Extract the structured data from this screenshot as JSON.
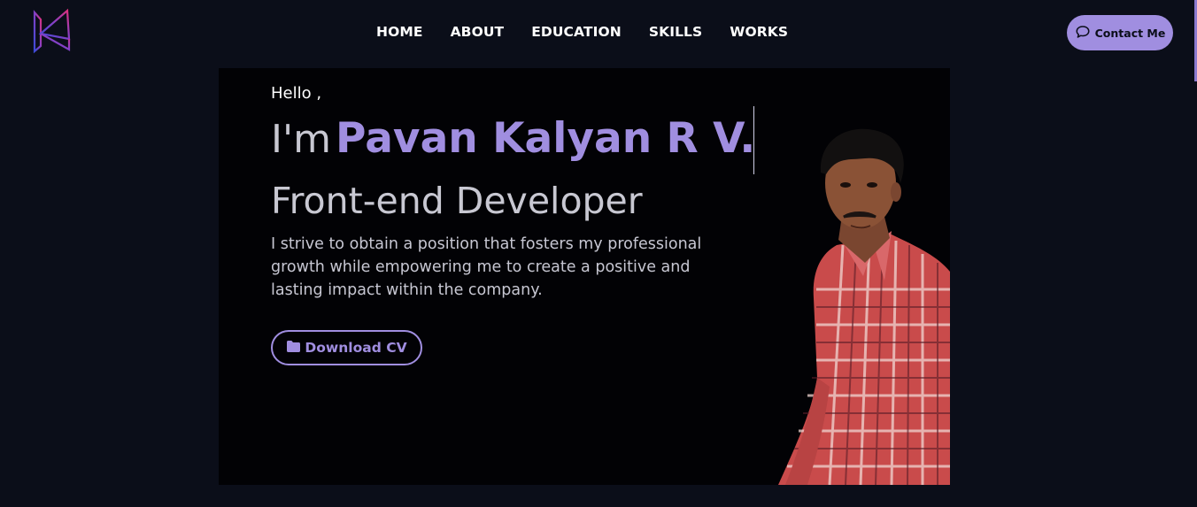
{
  "header": {
    "logo_icon": "k-logo-icon",
    "nav": [
      {
        "label": "HOME"
      },
      {
        "label": "ABOUT"
      },
      {
        "label": "EDUCATION"
      },
      {
        "label": "SKILLS"
      },
      {
        "label": "WORKS"
      }
    ],
    "contact": {
      "label": "Contact Me",
      "icon": "chat-bubble-icon"
    }
  },
  "hero": {
    "greeting": "Hello ,",
    "im": "I'm",
    "name": "Pavan Kalyan R V.",
    "role": "Front-end Developer",
    "description": "I strive to obtain a position that fosters my professional growth while empowering me to create a positive and lasting impact within the company.",
    "download": {
      "label": "Download CV",
      "icon": "folder-icon"
    },
    "photo_icon": "profile-photo"
  },
  "colors": {
    "background": "#0b0e19",
    "card": "#020205",
    "accent": "#a08ee0",
    "text": "#ffffff",
    "muted_text": "#c8c8d2"
  }
}
